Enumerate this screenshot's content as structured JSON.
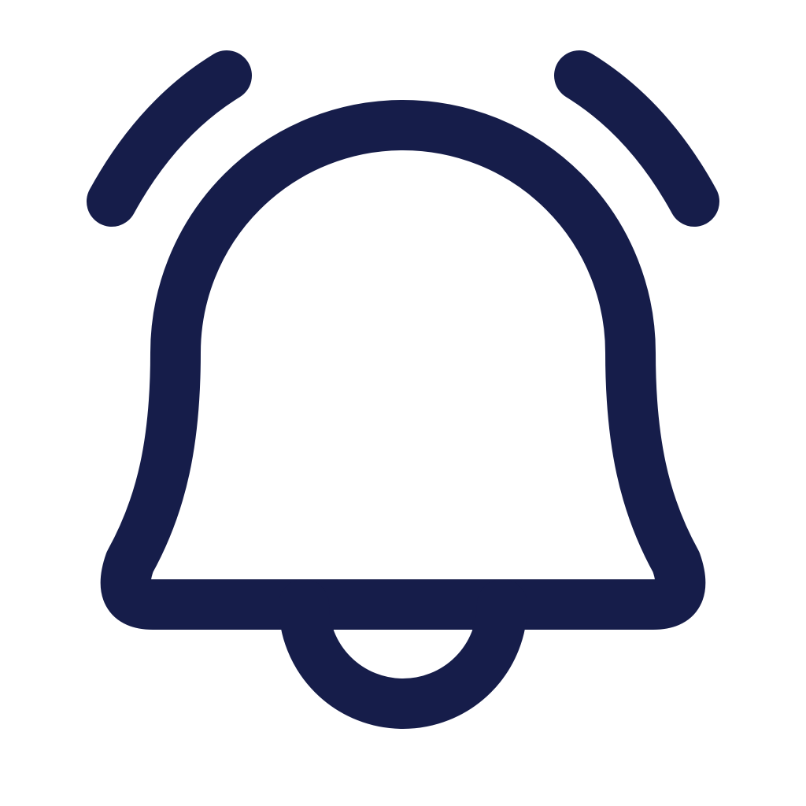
{
  "icon": {
    "name": "bell-ringing-icon",
    "stroke_color": "#161D4A",
    "background_color": "#FFFFFF"
  }
}
